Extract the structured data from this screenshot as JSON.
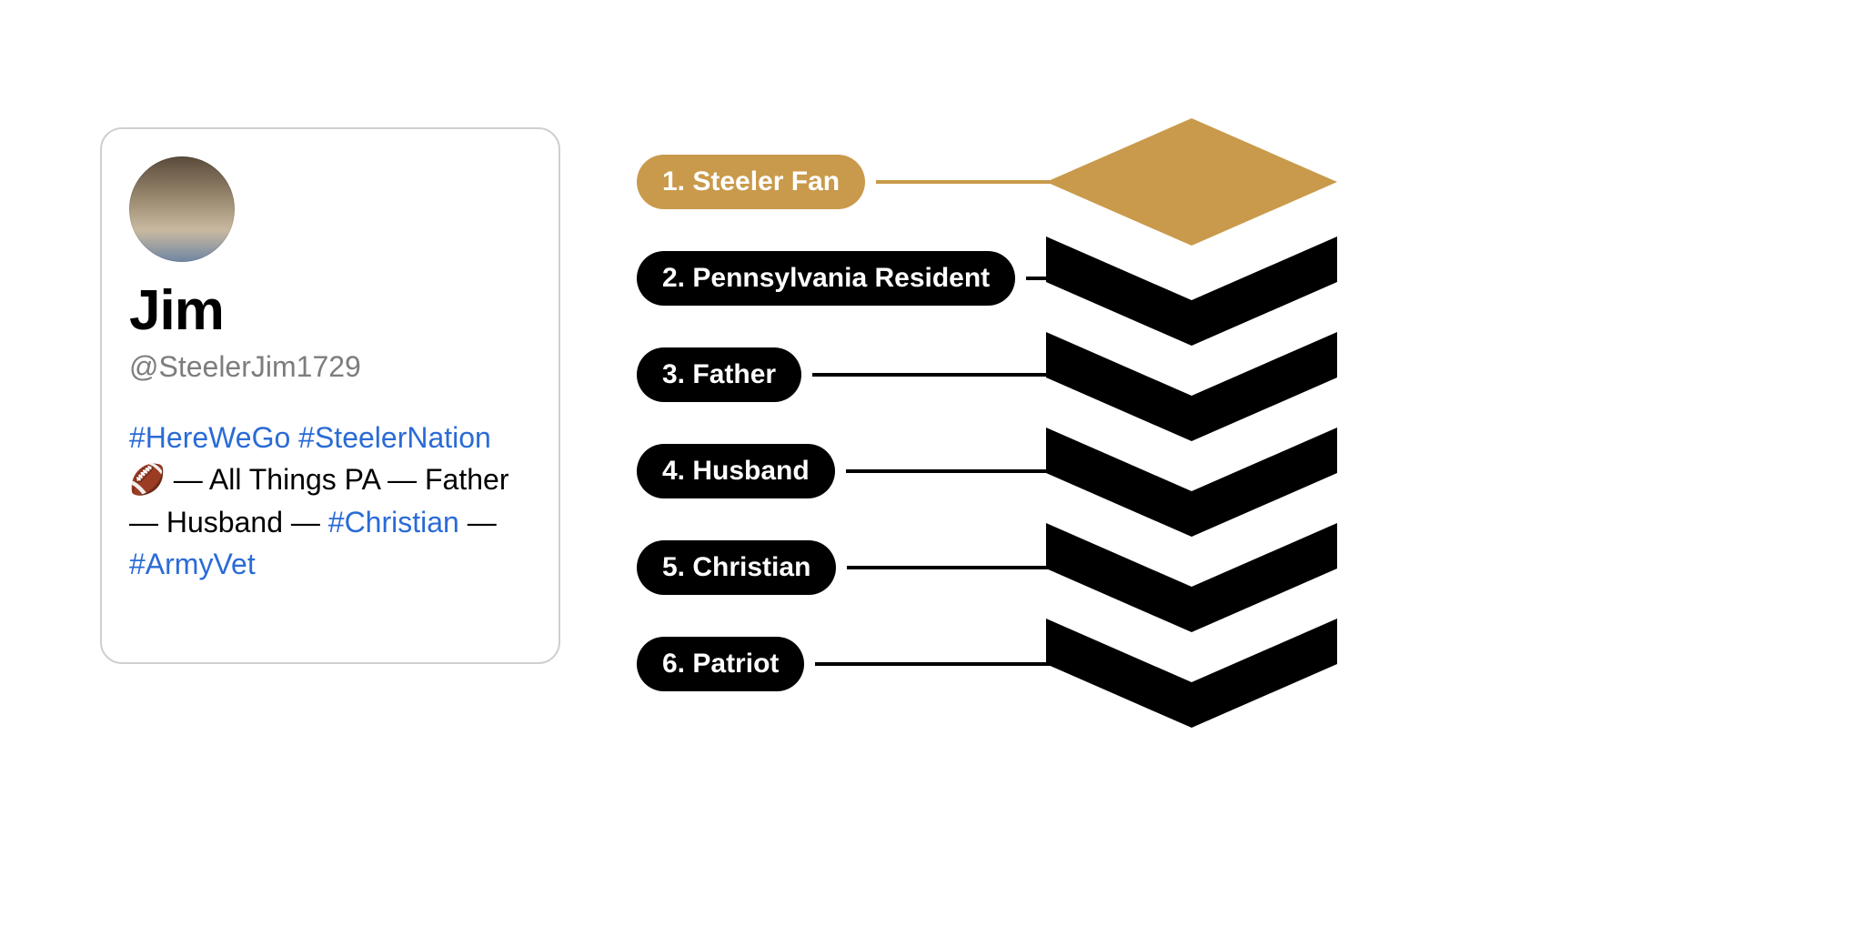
{
  "profile": {
    "name": "Jim",
    "handle": "@SteelerJim1729",
    "bio_parts": {
      "h1": "#HereWeGo",
      "h2": "#SteelerNation",
      "p1": "All Things PA",
      "p2": "Father",
      "p3": "Husband",
      "h3": "#Christian",
      "h4": "#ArmyVet"
    }
  },
  "identity_layers": [
    {
      "rank": "1.",
      "label": "Steeler Fan",
      "highlight": true
    },
    {
      "rank": "2.",
      "label": "Pennsylvania Resident",
      "highlight": false
    },
    {
      "rank": "3.",
      "label": "Father",
      "highlight": false
    },
    {
      "rank": "4.",
      "label": "Husband",
      "highlight": false
    },
    {
      "rank": "5.",
      "label": "Christian",
      "highlight": false
    },
    {
      "rank": "6.",
      "label": "Patriot",
      "highlight": false
    }
  ],
  "colors": {
    "gold": "#c99a4b",
    "black": "#000000",
    "link": "#2a6bd6",
    "muted": "#7d7d7d",
    "border": "#cfcfcf"
  }
}
